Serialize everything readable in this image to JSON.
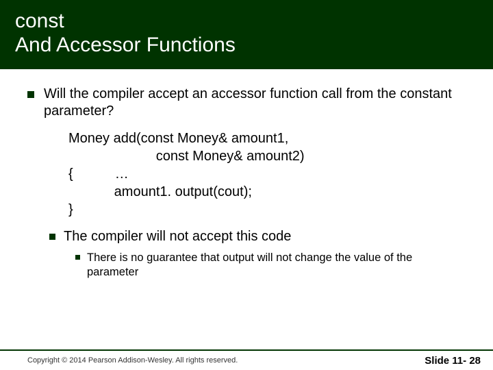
{
  "title": {
    "line1": "const",
    "line2": "And Accessor Functions"
  },
  "bullets": [
    {
      "text": "Will the compiler accept an accessor function call from the constant parameter?",
      "children": [
        {
          "text": "The compiler will not accept this code",
          "children": [
            {
              "text": "There is no guarantee that output will not change the value of the parameter"
            }
          ]
        }
      ]
    }
  ],
  "code": "Money add(const Money& amount1,\n                       const Money& amount2)\n{           …\n            amount1. output(cout);\n}",
  "footer": {
    "copyright": "Copyright © 2014 Pearson Addison-Wesley.  All rights reserved.",
    "slide_label": "Slide 11- 28"
  },
  "colors": {
    "title_bg": "#003300",
    "title_fg": "#ffffff",
    "bullet_square": "#003300",
    "footer_rule": "#003300"
  }
}
